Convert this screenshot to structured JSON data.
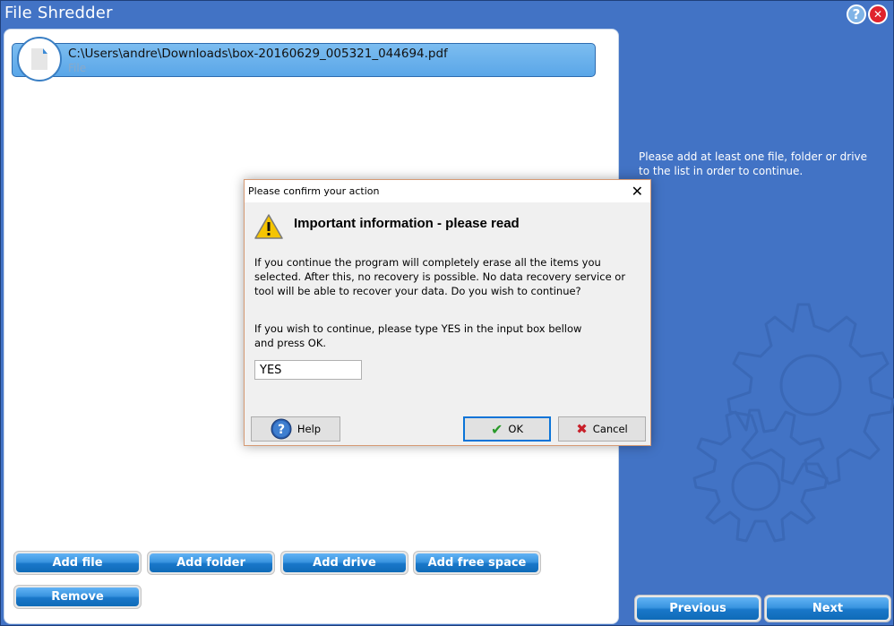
{
  "window": {
    "title": "File Shredder",
    "help_icon": "question-icon",
    "close_icon": "close-icon",
    "help_glyph": "?",
    "close_glyph": "✕"
  },
  "file_list": {
    "items": [
      {
        "path": "C:\\Users\\andre\\Downloads\\box-20160629_005321_044694.pdf",
        "type": "File",
        "icon": "file-icon"
      }
    ]
  },
  "actions": {
    "add_file": "Add file",
    "add_folder": "Add folder",
    "add_drive": "Add drive",
    "add_free_space": "Add free space",
    "remove": "Remove"
  },
  "side_panel": {
    "hint": "Please add at least one file, folder or drive to the list in order to continue.",
    "decor_icon": "gears-icon"
  },
  "navigation": {
    "previous": "Previous",
    "next": "Next"
  },
  "dialog": {
    "title": "Please confirm your action",
    "close_glyph": "✕",
    "heading": "Important information - please read",
    "warning_icon": "warning-icon",
    "body": "If you continue the program will completely erase all the items you selected. After this, no recovery is possible. No data recovery service or tool will be able to recover your data. Do you wish to continue?",
    "instruction": "If you wish to continue, please type YES in the input box bellow and press OK.",
    "input_value": "YES",
    "buttons": {
      "help": "Help",
      "ok": "OK",
      "cancel": "Cancel"
    }
  },
  "colors": {
    "background": "#4273c5",
    "button_blue": "#1977c9",
    "dialog_border": "#d69a74",
    "default_button_border": "#0a74d8",
    "close_red": "#e0232c"
  }
}
